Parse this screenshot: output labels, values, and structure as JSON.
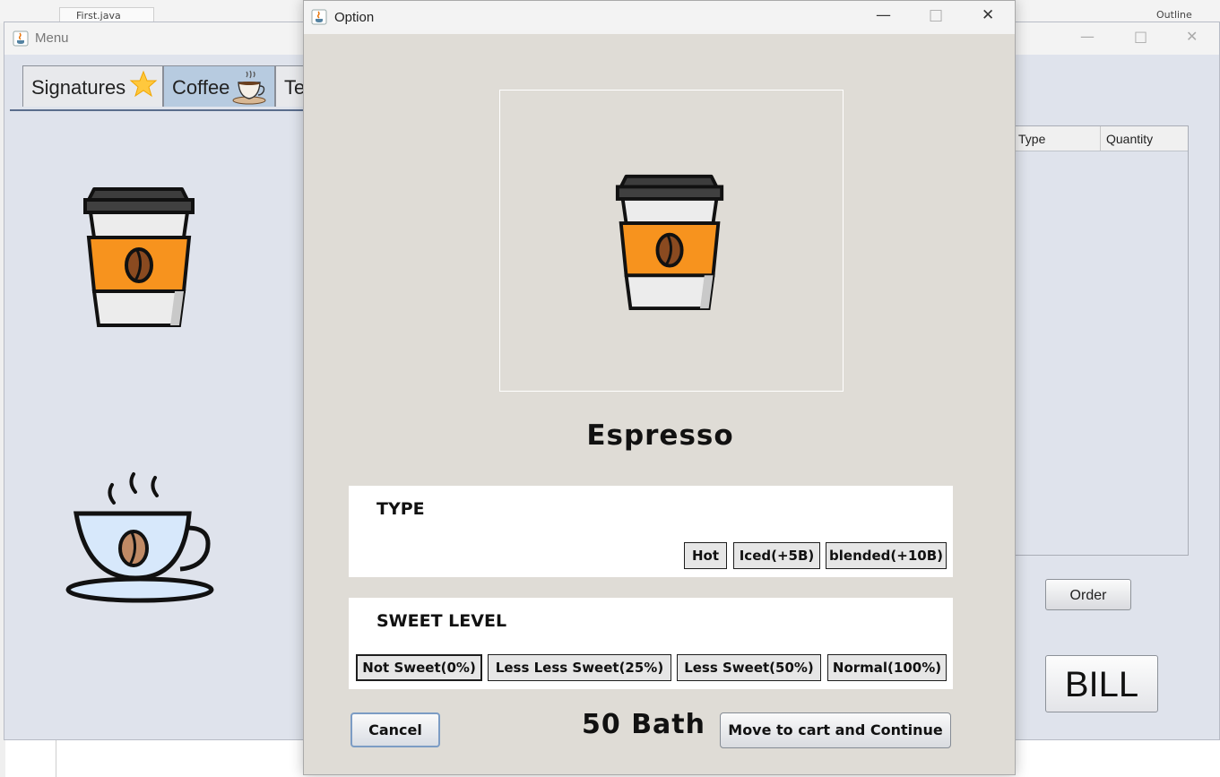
{
  "background_app": {
    "editor_tab": "First.java",
    "outline_label": "Outline"
  },
  "menu_window": {
    "title": "Menu",
    "tabs": [
      {
        "label": "Signatures",
        "icon": "star-icon",
        "selected": false
      },
      {
        "label": "Coffee",
        "icon": "coffee-cup-icon",
        "selected": true
      },
      {
        "label": "Te",
        "icon": "",
        "selected": false
      }
    ],
    "products": [
      {
        "icon": "takeaway-coffee-cup-icon"
      },
      {
        "icon": "hot-coffee-cup-icon"
      }
    ],
    "table": {
      "columns": [
        "Type",
        "Quantity"
      ],
      "rows": []
    },
    "order_label": "Order",
    "bill_label": "BILL"
  },
  "dialog": {
    "title": "Option",
    "product_name": "Espresso",
    "product_icon": "takeaway-coffee-cup-icon",
    "type_section": {
      "title": "TYPE",
      "options": [
        "Hot",
        "Iced(+5B)",
        "blended(+10B)"
      ]
    },
    "sweet_section": {
      "title": "SWEET LEVEL",
      "options": [
        "Not Sweet(0%)",
        "Less Less Sweet(25%)",
        "Less Sweet(50%)",
        "Normal(100%)"
      ]
    },
    "cancel_label": "Cancel",
    "price_text": "50 Bath",
    "continue_label": "Move to cart and Continue"
  },
  "colors": {
    "dialog_bg": "#dfdcd6",
    "menu_bg": "#dfe3ec",
    "cup_sleeve": "#f7931e",
    "selected_tab": "#b7cbe0"
  }
}
